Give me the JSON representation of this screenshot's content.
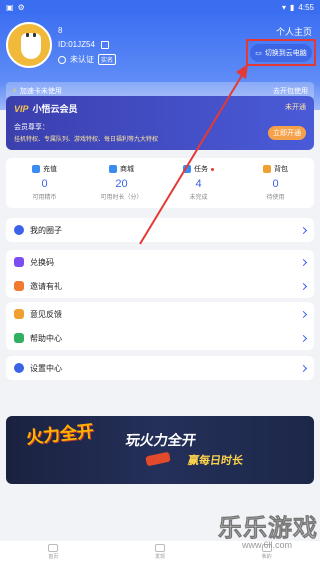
{
  "status_bar": {
    "left_icons": [
      "image-icon",
      "gear-icon"
    ],
    "time": "4:55"
  },
  "profile": {
    "username": "8",
    "user_id": "ID:01JZ54",
    "verify_status": "未认证",
    "verify_tag": "实名",
    "homepage_label": "个人主页",
    "switch_button_label": "切换到云电脑"
  },
  "speed_bar": {
    "left_text": "加速卡未使用",
    "right_text": "去开包使用"
  },
  "vip": {
    "logo": "VIP",
    "title": "小悟云会员",
    "status": "未开通",
    "perk_label": "会员尊享：",
    "perks": "挂机特权、专属队列、游戏特权、每日福利等九大特权",
    "button": "立即开通"
  },
  "stats": [
    {
      "title": "充值",
      "value": "0",
      "desc": "可用精币",
      "color": "#3b8cf0"
    },
    {
      "title": "商城",
      "value": "20",
      "desc": "可用时长（分）",
      "color": "#3b8cf0"
    },
    {
      "title": "任务",
      "value": "4",
      "desc": "未完成",
      "color": "#3b8cf0"
    },
    {
      "title": "背包",
      "value": "0",
      "desc": "待使用",
      "color": "#f0a030"
    }
  ],
  "menu": {
    "circle": "我的圈子",
    "group1": [
      "兑换码",
      "邀请有礼"
    ],
    "group2": [
      "意见反馈",
      "帮助中心"
    ],
    "settings": "设置中心"
  },
  "banner": {
    "left": "火力全开",
    "main": "玩火力全开",
    "sub": "赢每日时长"
  },
  "bottom_nav": [
    "首页",
    "发现",
    "我的"
  ],
  "watermark": {
    "text": "乐乐游戏",
    "url": "www.6ll.com"
  },
  "colors": {
    "primary": "#3b63e8",
    "annotation": "#e53935"
  }
}
